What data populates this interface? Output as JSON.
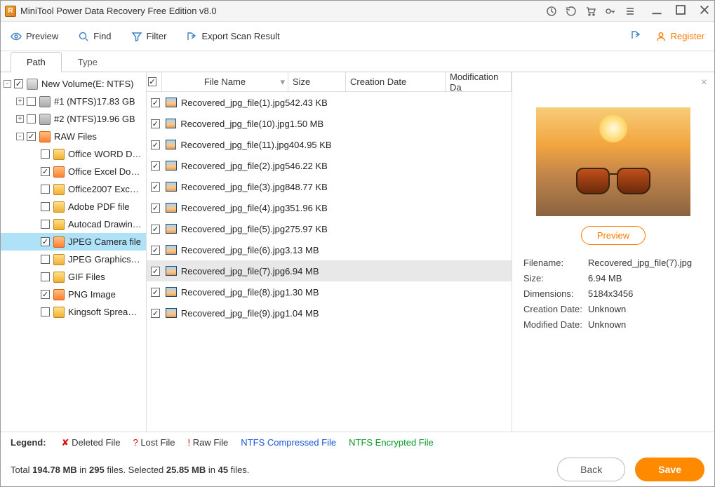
{
  "title": "MiniTool Power Data Recovery Free Edition v8.0",
  "toolbar": {
    "preview": "Preview",
    "find": "Find",
    "filter": "Filter",
    "export": "Export Scan Result",
    "register": "Register"
  },
  "tabs": {
    "path": "Path",
    "type": "Type"
  },
  "tree": {
    "root": {
      "label": "New Volume(E: NTFS)",
      "checked": true,
      "exp": "-"
    },
    "parts": [
      {
        "label": "#1 (NTFS)17.83 GB",
        "checked": false,
        "exp": "+"
      },
      {
        "label": "#2 (NTFS)19.96 GB",
        "checked": false,
        "exp": "+"
      }
    ],
    "raw": {
      "label": "RAW Files",
      "checked": true,
      "exp": "-"
    },
    "rawkids": [
      {
        "label": "Office WORD D…",
        "checked": false,
        "sel": false
      },
      {
        "label": "Office Excel Do…",
        "checked": true,
        "sel": false
      },
      {
        "label": "Office2007 Exc…",
        "checked": false,
        "sel": false
      },
      {
        "label": "Adobe PDF file",
        "checked": false,
        "sel": false
      },
      {
        "label": "Autocad Drawin…",
        "checked": false,
        "sel": false
      },
      {
        "label": "JPEG Camera file",
        "checked": true,
        "sel": true
      },
      {
        "label": "JPEG Graphics…",
        "checked": false,
        "sel": false
      },
      {
        "label": "GIF Files",
        "checked": false,
        "sel": false
      },
      {
        "label": "PNG Image",
        "checked": true,
        "sel": false
      },
      {
        "label": "Kingsoft Sprea…",
        "checked": false,
        "sel": false
      }
    ]
  },
  "columns": {
    "name": "File Name",
    "size": "Size",
    "cdate": "Creation Date",
    "mdate": "Modification Da"
  },
  "files": [
    {
      "name": "Recovered_jpg_file(1).jpg",
      "size": "542.43 KB",
      "sel": false
    },
    {
      "name": "Recovered_jpg_file(10).jpg",
      "size": "1.50 MB",
      "sel": false
    },
    {
      "name": "Recovered_jpg_file(11).jpg",
      "size": "404.95 KB",
      "sel": false
    },
    {
      "name": "Recovered_jpg_file(2).jpg",
      "size": "546.22 KB",
      "sel": false
    },
    {
      "name": "Recovered_jpg_file(3).jpg",
      "size": "848.77 KB",
      "sel": false
    },
    {
      "name": "Recovered_jpg_file(4).jpg",
      "size": "351.96 KB",
      "sel": false
    },
    {
      "name": "Recovered_jpg_file(5).jpg",
      "size": "275.97 KB",
      "sel": false
    },
    {
      "name": "Recovered_jpg_file(6).jpg",
      "size": "3.13 MB",
      "sel": false
    },
    {
      "name": "Recovered_jpg_file(7).jpg",
      "size": "6.94 MB",
      "sel": true
    },
    {
      "name": "Recovered_jpg_file(8).jpg",
      "size": "1.30 MB",
      "sel": false
    },
    {
      "name": "Recovered_jpg_file(9).jpg",
      "size": "1.04 MB",
      "sel": false
    }
  ],
  "preview": {
    "button": "Preview",
    "labels": {
      "filename": "Filename:",
      "size": "Size:",
      "dims": "Dimensions:",
      "cdate": "Creation Date:",
      "mdate": "Modified Date:"
    },
    "values": {
      "filename": "Recovered_jpg_file(7).jpg",
      "size": "6.94 MB",
      "dims": "5184x3456",
      "cdate": "Unknown",
      "mdate": "Unknown"
    }
  },
  "legend": {
    "title": "Legend:",
    "deleted": "Deleted File",
    "lost": "Lost File",
    "raw": "Raw File",
    "ntfsc": "NTFS Compressed File",
    "ntfse": "NTFS Encrypted File",
    "xmark": "✘",
    "qmark": "?",
    "emark": "!"
  },
  "status": {
    "t1": "Total ",
    "mb": "194.78 MB",
    "t2": " in ",
    "fc": "295",
    "t3": " files.   Selected ",
    "smb": "25.85 MB",
    "t4": " in ",
    "sfc": "45",
    "t5": " files.",
    "back": "Back",
    "save": "Save"
  }
}
